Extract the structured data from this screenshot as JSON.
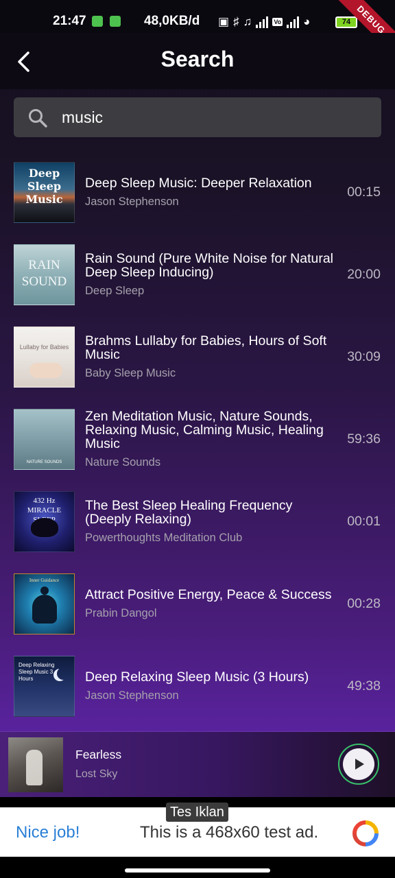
{
  "status_bar": {
    "time": "21:47",
    "net_speed": "48,0KB/d",
    "battery": "74",
    "debug_label": "DEBUG"
  },
  "header": {
    "title": "Search",
    "back_icon": "back-chevron-icon"
  },
  "search": {
    "value": "music",
    "icon": "search-icon"
  },
  "tracks": [
    {
      "title": "Deep Sleep Music: Deeper Relaxation",
      "artist": "Jason Stephenson",
      "duration": "00:15",
      "thumb_caption": "Deep Sleep Music"
    },
    {
      "title": "Rain Sound (Pure White Noise for Natural Deep Sleep Inducing)",
      "artist": "Deep Sleep",
      "duration": "20:00",
      "thumb_caption": "RAIN SOUND"
    },
    {
      "title": "Brahms Lullaby for Babies, Hours of Soft Music",
      "artist": "Baby Sleep Music",
      "duration": "30:09",
      "thumb_caption": "Lullaby for Babies"
    },
    {
      "title": "Zen Meditation Music, Nature Sounds, Relaxing Music, Calming Music, Healing Music",
      "artist": "Nature Sounds",
      "duration": "59:36",
      "thumb_caption": "NATURE SOUNDS"
    },
    {
      "title": "The Best Sleep Healing Frequency (Deeply Relaxing)",
      "artist": "Powerthoughts Meditation Club",
      "duration": "00:01",
      "thumb_caption": "432 Hz MIRACLE SLEEP"
    },
    {
      "title": "Attract Positive Energy, Peace & Success",
      "artist": "Prabin Dangol",
      "duration": "00:28",
      "thumb_caption": "Inner Guidance"
    },
    {
      "title": "Deep Relaxing Sleep Music (3 Hours)",
      "artist": "Jason Stephenson",
      "duration": "49:38",
      "thumb_caption": "Deep Relaxing Sleep Music 3 Hours"
    }
  ],
  "now_playing": {
    "title": "Fearless",
    "artist": "Lost Sky",
    "play_icon": "play-icon"
  },
  "ad": {
    "label": "Tes Iklan",
    "nice": "Nice job!",
    "text": "This is a 468x60 test ad."
  },
  "colors": {
    "accent_purple": "#5a23a0",
    "play_ring": "#39c26a",
    "ad_link": "#2a7fd6"
  }
}
